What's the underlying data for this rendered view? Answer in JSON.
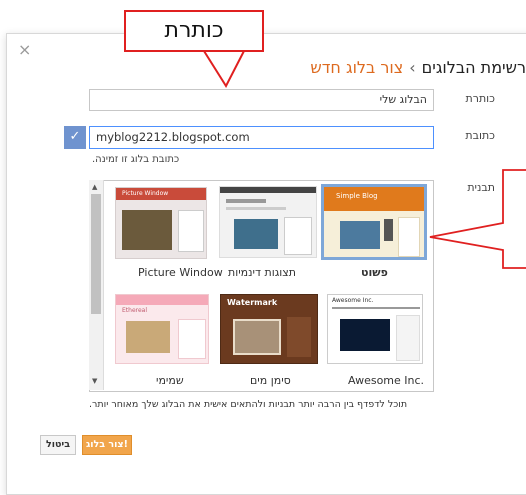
{
  "callout": {
    "text": "כותרת"
  },
  "dialog": {
    "close_glyph": "×",
    "breadcrumb": {
      "home": "רשימת הבלוגים",
      "separator": "›",
      "current": "צור בלוג חדש"
    },
    "fields": {
      "title_label": "כותרת",
      "title_value": "הבלוג שלי",
      "address_label": "כתובת",
      "address_value": "myblog2212.blogspot.com",
      "address_check_glyph": "✓",
      "availability_note": "כתובת בלוג זו זמינה.",
      "template_label": "תבנית"
    },
    "templates": [
      {
        "name": "פשוט",
        "header": "Simple Blog",
        "selected": true
      },
      {
        "name": "תצוגות דינמיות",
        "selected": false
      },
      {
        "name": "Picture Window",
        "header": "Picture Window",
        "selected": false
      },
      {
        "name": "Awesome Inc.",
        "header": "Awesome Inc.",
        "selected": false
      },
      {
        "name": "סימן מים",
        "header": "Watermark",
        "selected": false
      },
      {
        "name": "שמימי",
        "header": "Ethereal",
        "selected": false
      }
    ],
    "hint": "תוכל לדפדף בין הרבה יותר תבניות ולהתאים אישית את הבלוג שלך מאוחר יותר.",
    "buttons": {
      "create": "צור בלוג!",
      "cancel": "ביטול"
    }
  },
  "colors": {
    "accent_orange": "#dd6a1f",
    "create_button": "#f1a54b",
    "selection_blue": "#7ea7d8",
    "annotation_red": "#e02020"
  }
}
